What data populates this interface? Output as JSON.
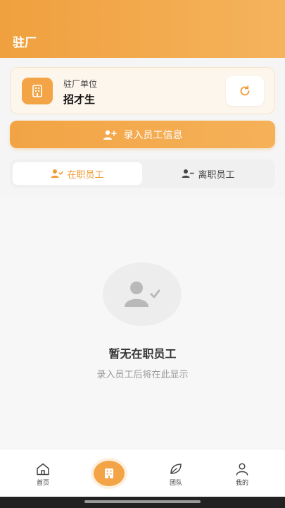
{
  "header": {
    "title": "驻厂"
  },
  "unit": {
    "label": "驻厂单位",
    "name": "招才生"
  },
  "actions": {
    "enter_label": "录入员工信息"
  },
  "tabs": [
    {
      "label": "在职员工",
      "active": true
    },
    {
      "label": "离职员工",
      "active": false
    }
  ],
  "empty_state": {
    "title": "暂无在职员工",
    "subtitle": "录入员工后将在此显示"
  },
  "nav": [
    {
      "label": "首页",
      "icon": "home-icon"
    },
    {
      "label": "",
      "icon": "building-icon"
    },
    {
      "label": "团队",
      "icon": "leaf-icon"
    },
    {
      "label": "我的",
      "icon": "person-icon"
    }
  ],
  "colors": {
    "accent": "#f3a447",
    "accent_text": "#f09a30"
  }
}
